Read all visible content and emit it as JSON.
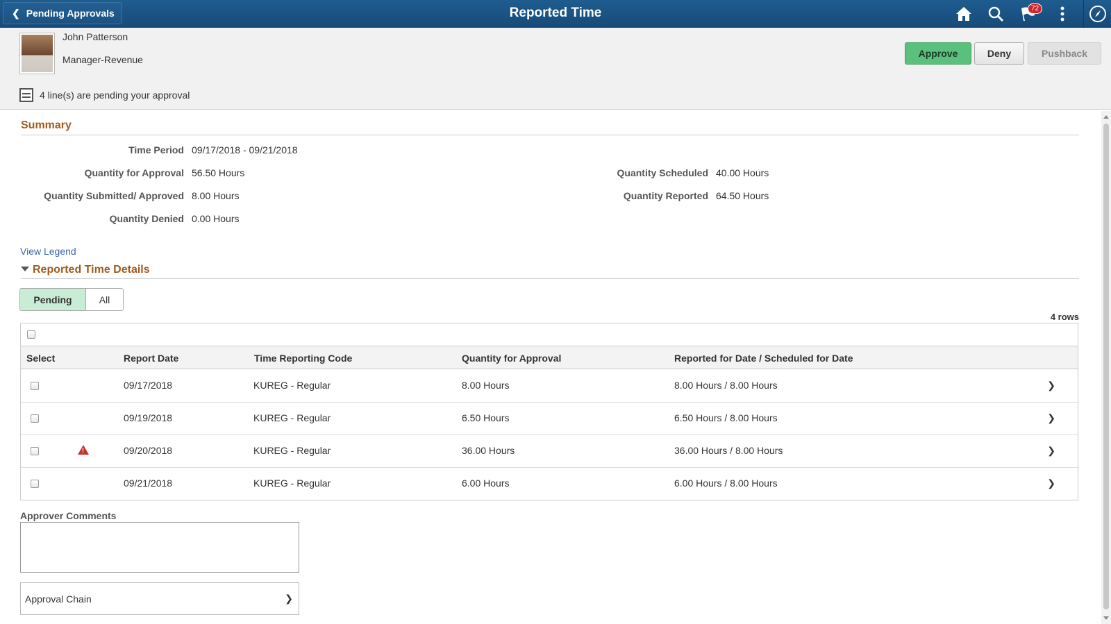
{
  "banner": {
    "back_label": "Pending Approvals",
    "title": "Reported Time",
    "notification_count": "72",
    "icons": [
      "home-icon",
      "search-icon",
      "notification-flag-icon",
      "actions-menu-icon",
      "navbar-compass-icon"
    ]
  },
  "employee": {
    "name": "John Patterson",
    "job_title": "Manager-Revenue"
  },
  "actions": {
    "approve": "Approve",
    "deny": "Deny",
    "pushback": "Pushback"
  },
  "pending_note": "4 line(s) are pending your approval",
  "summary": {
    "title": "Summary",
    "time_period_label": "Time Period",
    "time_period_value": "09/17/2018 - 09/21/2018",
    "qty_approval_label": "Quantity for Approval",
    "qty_approval_value": "56.50 Hours",
    "qty_submitted_label": "Quantity Submitted/ Approved",
    "qty_submitted_value": "8.00 Hours",
    "qty_denied_label": "Quantity Denied",
    "qty_denied_value": "0.00 Hours",
    "qty_scheduled_label": "Quantity Scheduled",
    "qty_scheduled_value": "40.00 Hours",
    "qty_reported_label": "Quantity Reported",
    "qty_reported_value": "64.50 Hours"
  },
  "legend_link": "View Legend",
  "details": {
    "title": "Reported Time Details",
    "tabs": [
      "Pending",
      "All"
    ],
    "rows_count": "4 rows",
    "columns": [
      "Select",
      "Report Date",
      "Time Reporting Code",
      "Quantity for Approval",
      "Reported for Date / Scheduled for Date"
    ],
    "rows": [
      {
        "date": "09/17/2018",
        "trc": "KUREG - Regular",
        "qty": "8.00 Hours",
        "reported": "8.00 Hours / 8.00 Hours"
      },
      {
        "date": "09/19/2018",
        "trc": "KUREG - Regular",
        "qty": "6.50 Hours",
        "reported": "6.50 Hours / 8.00 Hours"
      },
      {
        "date": "09/20/2018",
        "trc": "KUREG - Regular",
        "qty": "36.00 Hours",
        "reported": "36.00 Hours / 8.00 Hours"
      },
      {
        "date": "09/21/2018",
        "trc": "KUREG - Regular",
        "qty": "6.00 Hours",
        "reported": "6.00 Hours / 8.00 Hours"
      }
    ]
  },
  "comments_label": "Approver Comments",
  "approval_chain_label": "Approval Chain",
  "colors": {
    "banner": "#1f5c8f",
    "section_title": "#a15a1f",
    "approve_button": "#5ac07d",
    "warning": "#c9302c",
    "link": "#3a66b5"
  }
}
